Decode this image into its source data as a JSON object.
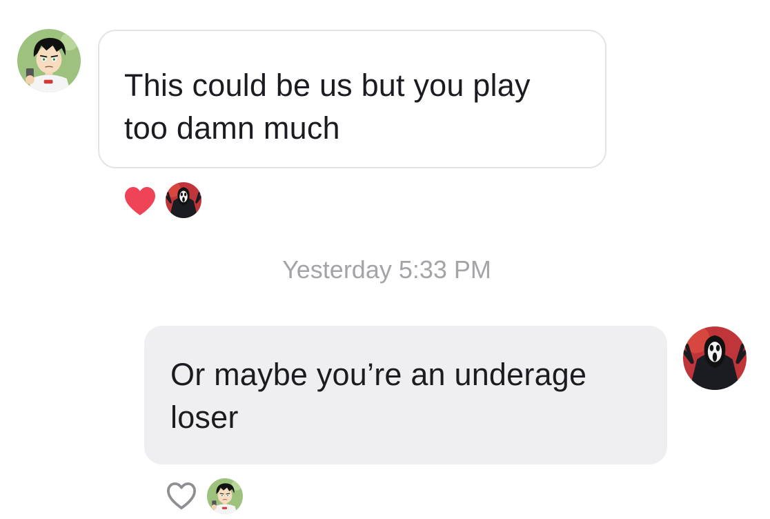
{
  "messages": [
    {
      "direction": "incoming",
      "text_line1": "This could be us but you play",
      "text_line2": "too damn much",
      "sender_avatar": "cartoon-boy-avatar",
      "reaction": {
        "liked": true,
        "heart_color": "#ef4358",
        "reactor_avatar": "ghostface-avatar"
      }
    },
    {
      "direction": "outgoing",
      "text_line1": "Or maybe you’re an underage",
      "text_line2": "loser",
      "sender_avatar": "ghostface-avatar",
      "reaction": {
        "liked": false,
        "heart_color": "#8e8e93",
        "reactor_avatar": "cartoon-boy-avatar"
      }
    }
  ],
  "timestamp": "Yesterday 5:33 PM",
  "colors": {
    "incoming_border": "#e3e3e6",
    "outgoing_background": "#efeff2",
    "timestamp_text": "#a3a3a8",
    "text": "#1c1b21"
  }
}
